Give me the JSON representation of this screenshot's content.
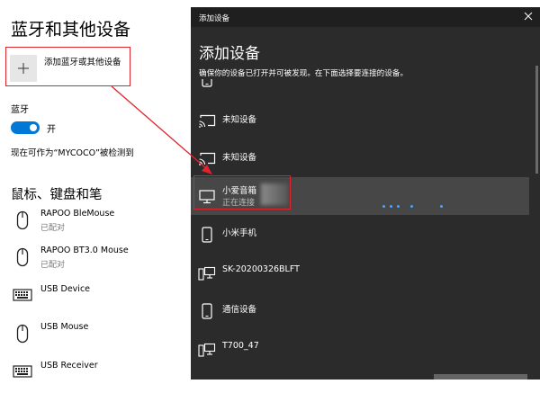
{
  "settings": {
    "title": "蓝牙和其他设备",
    "add_device_label": "添加蓝牙或其他设备",
    "bluetooth_label": "蓝牙",
    "bluetooth_state": "开",
    "discoverable_text": "现在可作为“MYCOCO”被检测到",
    "section_title": "鼠标、键盘和笔",
    "devices": [
      {
        "name": "RAPOO BleMouse",
        "status": "已配对",
        "icon": "mouse-icon"
      },
      {
        "name": "RAPOO BT3.0 Mouse",
        "status": "已配对",
        "icon": "mouse-icon"
      },
      {
        "name": "USB Device",
        "status": "",
        "icon": "keyboard-icon"
      },
      {
        "name": "USB Mouse",
        "status": "",
        "icon": "mouse-icon"
      },
      {
        "name": "USB Receiver",
        "status": "",
        "icon": "keyboard-icon"
      }
    ]
  },
  "dialog": {
    "window_title": "添加设备",
    "heading": "添加设备",
    "subtitle": "确保你的设备已打开并可被发现。在下面选择要连接的设备。",
    "items": [
      {
        "name": "",
        "status": "",
        "icon": "phone-icon"
      },
      {
        "name": "未知设备",
        "status": "",
        "icon": "cast-display-icon"
      },
      {
        "name": "未知设备",
        "status": "",
        "icon": "cast-display-icon"
      },
      {
        "name": "小爱音箱",
        "status": "正在连接",
        "icon": "monitor-icon"
      },
      {
        "name": "小米手机",
        "status": "",
        "icon": "phone-icon"
      },
      {
        "name": "SK-20200326BLFT",
        "status": "",
        "icon": "computer-icon"
      },
      {
        "name": "通信设备",
        "status": "",
        "icon": "phone-icon"
      },
      {
        "name": "T700_47",
        "status": "",
        "icon": "computer-icon"
      }
    ]
  },
  "colors": {
    "accent": "#0078d7",
    "annotation": "#e0242d",
    "dialog_bg": "#2b2b2b",
    "selected_bg": "#474747"
  }
}
